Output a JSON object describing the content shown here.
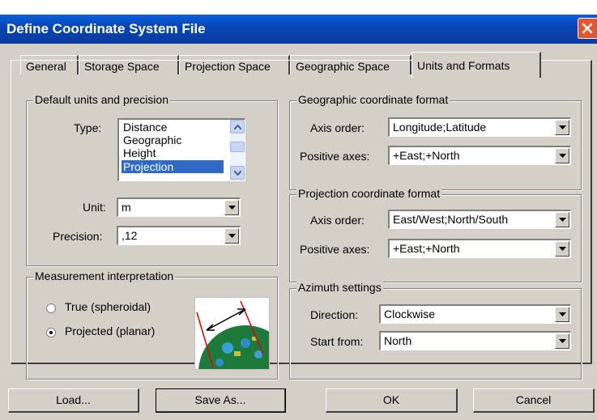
{
  "window": {
    "title": "Define Coordinate System File"
  },
  "tabs": [
    {
      "label": "General"
    },
    {
      "label": "Storage Space"
    },
    {
      "label": "Projection Space"
    },
    {
      "label": "Geographic Space"
    },
    {
      "label": "Units and Formats",
      "active": true
    }
  ],
  "units": {
    "group_title": "Default units and precision",
    "type_label": "Type:",
    "type_options": [
      "Distance",
      "Geographic",
      "Height",
      "Projection"
    ],
    "type_selected": "Projection",
    "unit_label": "Unit:",
    "unit_value": "m",
    "precision_label": "Precision:",
    "precision_value": ",12"
  },
  "measurement": {
    "group_title": "Measurement interpretation",
    "option_true": "True (spheroidal)",
    "option_projected": "Projected (planar)",
    "selected": "Projected (planar)"
  },
  "geographic_format": {
    "group_title": "Geographic coordinate format",
    "axis_order_label": "Axis order:",
    "axis_order_value": "Longitude;Latitude",
    "positive_axes_label": "Positive axes:",
    "positive_axes_value": "+East;+North"
  },
  "projection_format": {
    "group_title": "Projection coordinate format",
    "axis_order_label": "Axis order:",
    "axis_order_value": "East/West;North/South",
    "positive_axes_label": "Positive axes:",
    "positive_axes_value": "+East;+North"
  },
  "azimuth": {
    "group_title": "Azimuth settings",
    "direction_label": "Direction:",
    "direction_value": "Clockwise",
    "start_label": "Start from:",
    "start_value": "North"
  },
  "buttons": {
    "load": "Load...",
    "save_as": "Save As...",
    "ok": "OK",
    "cancel": "Cancel"
  },
  "colors": {
    "titlebar": "#0a4fc4",
    "face": "#d4d0c8",
    "selection": "#316ac5",
    "close": "#e4552e"
  }
}
